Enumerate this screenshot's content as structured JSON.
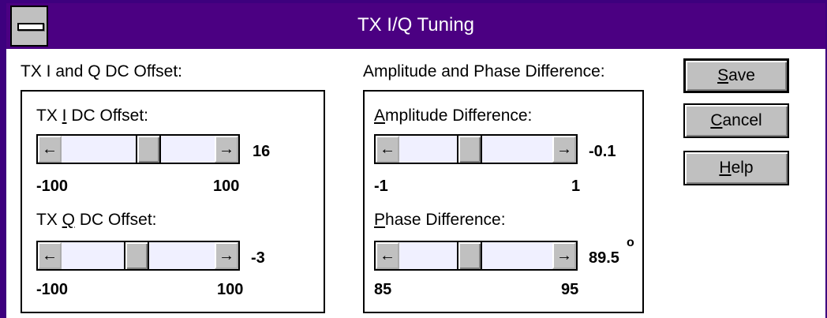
{
  "window": {
    "title": "TX I/Q Tuning"
  },
  "left_group": {
    "label": "TX I and Q DC Offset:",
    "i_offset": {
      "prefix": "TX ",
      "mnemonic": "I",
      "suffix": " DC Offset:",
      "value": "16",
      "min": "-100",
      "max": "100",
      "level": 0.58
    },
    "q_offset": {
      "prefix": "TX ",
      "mnemonic": "Q",
      "suffix": " DC Offset:",
      "value": "-3",
      "min": "-100",
      "max": "100",
      "level": 0.485
    }
  },
  "right_group": {
    "label": "Amplitude and Phase Difference:",
    "amplitude": {
      "mnemonic": "A",
      "rest": "mplitude Difference:",
      "value": "-0.1",
      "min": "-1",
      "max": "1",
      "level": 0.45
    },
    "phase": {
      "mnemonic": "P",
      "rest": "hase Difference:",
      "value": "89.5",
      "unit": "o",
      "min": "85",
      "max": "95",
      "level": 0.45
    }
  },
  "buttons": {
    "save": {
      "mnemonic": "S",
      "rest": "ave"
    },
    "cancel": {
      "mnemonic": "C",
      "rest": "ancel"
    },
    "help": {
      "mnemonic": "H",
      "rest": "elp"
    }
  },
  "icons": {
    "left_arrow": "←",
    "right_arrow": "→"
  }
}
